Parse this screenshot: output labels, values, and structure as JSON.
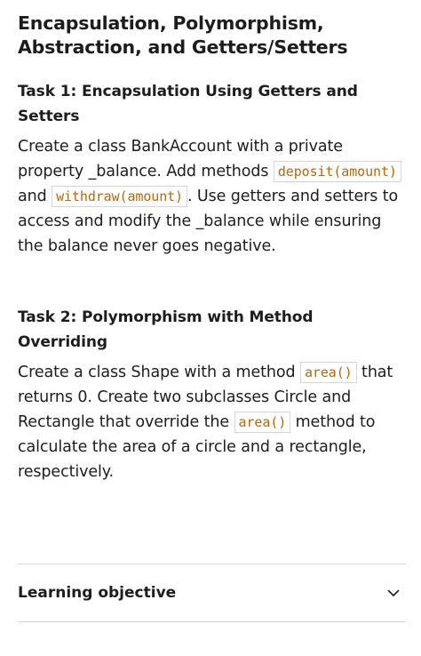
{
  "main_title": "Encapsulation, Polymorphism, Abstraction, and Getters/Setters",
  "tasks": [
    {
      "title": "Task 1: Encapsulation Using Getters and Setters",
      "text_1": "Create a class BankAccount with a private property _balance. Add methods ",
      "code_1": "deposit(amount)",
      "text_2": " and ",
      "code_2": "withdraw(amount)",
      "text_3": ". Use getters and setters to access and modify the _balance while ensuring the balance never goes negative."
    },
    {
      "title": "Task 2: Polymorphism with Method Overriding",
      "text_1": "Create a class Shape with a method ",
      "code_1": "area()",
      "text_2": " that returns 0. Create two subclasses Circle and Rectangle that override the ",
      "code_2": "area()",
      "text_3": " method to calculate the area of a circle and a rectangle, respectively."
    }
  ],
  "accordion": {
    "label": "Learning objective",
    "icon": "chevron-down-icon",
    "expanded": false
  },
  "colors": {
    "text": "#1c1d1f",
    "code": "#b4690e",
    "divider": "#d1d7dc"
  }
}
